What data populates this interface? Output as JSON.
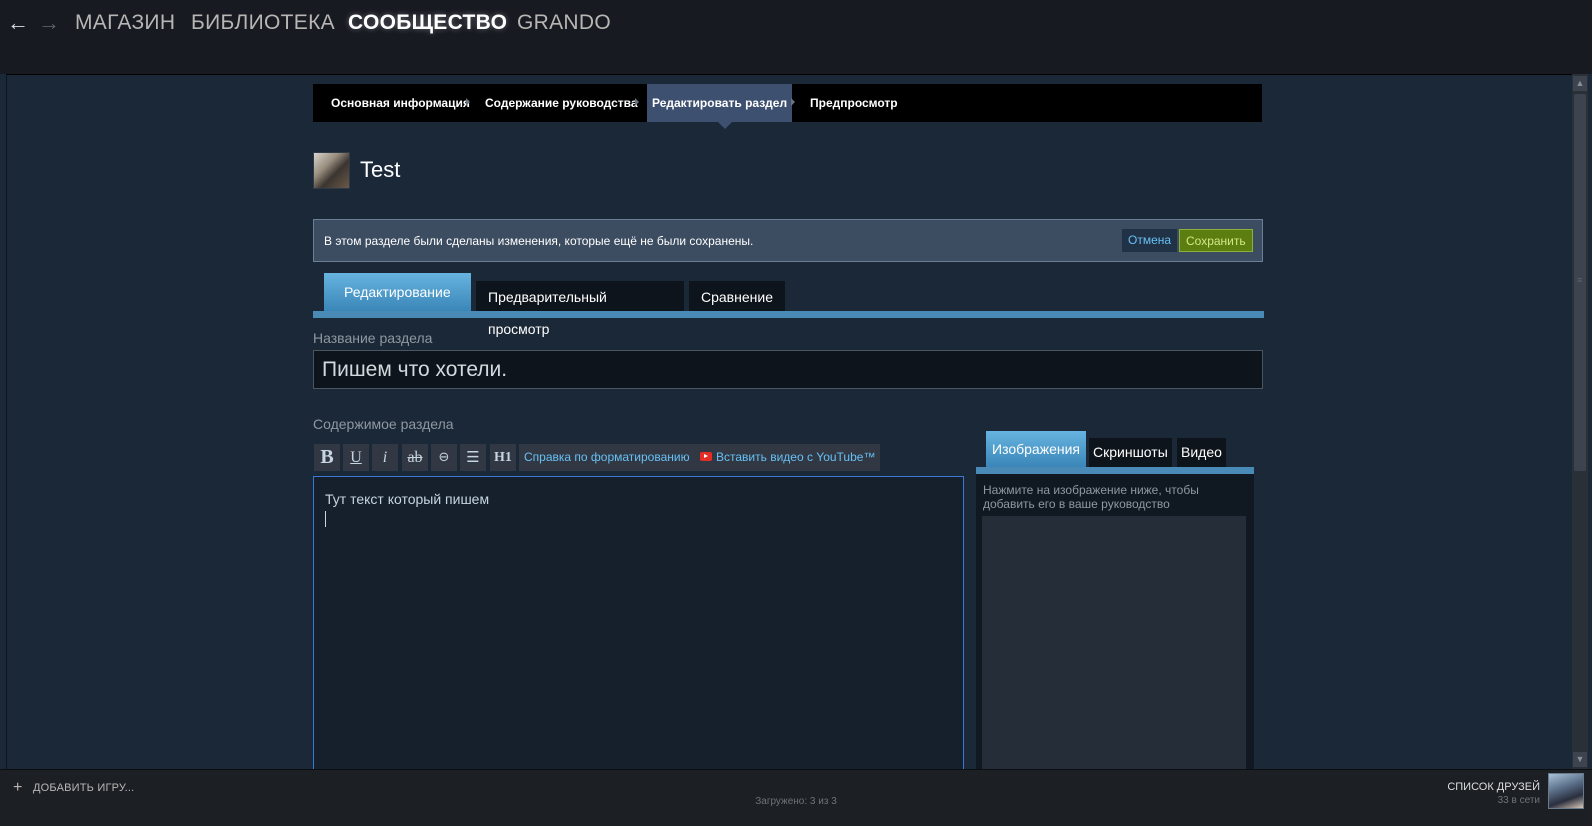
{
  "topnav": {
    "back_icon": "arrow-left-icon",
    "forward_icon": "arrow-right-icon",
    "store": "МАГАЗИН",
    "library": "БИБЛИОТЕКА",
    "community": "СООБЩЕСТВО",
    "user": "GRANDO"
  },
  "breadcrumb": {
    "items": [
      "Основная информация",
      "Содержание руководства",
      "Редактировать раздел",
      "Предпросмотр"
    ],
    "active_index": 2
  },
  "author": {
    "name": "Test"
  },
  "notice": {
    "text": "В этом разделе были сделаны изменения, которые ещё не были сохранены.",
    "cancel": "Отмена",
    "save": "Сохранить"
  },
  "edit_tabs": [
    "Редактирование",
    "Предварительный просмотр",
    "Сравнение"
  ],
  "title_field": {
    "label": "Название раздела",
    "value": "Пишем что хотели."
  },
  "content_field": {
    "label": "Содержимое раздела",
    "text": "Тут текст который пишем"
  },
  "toolbar": {
    "bold": "B",
    "underline": "U",
    "italic": "i",
    "strike": "ab",
    "link": "⊖",
    "list": "☰",
    "heading": "H1",
    "help": "Справка по форматированию",
    "youtube": "Вставить видео с YouTube™"
  },
  "media": {
    "tabs": [
      "Изображения",
      "Скриншоты",
      "Видео"
    ],
    "hint": "Нажмите на изображение ниже, чтобы добавить его в ваше руководство"
  },
  "footer": {
    "add_game": "ДОБАВИТЬ ИГРУ...",
    "status": "Загружено: 3 из 3",
    "friends": "СПИСОК ДРУЗЕЙ",
    "online": "33 в сети"
  },
  "colors": {
    "background": "#1b2838",
    "accent": "#66c0f4",
    "tab_active": "#4a8ab7",
    "save_green": "#5c7e10"
  }
}
